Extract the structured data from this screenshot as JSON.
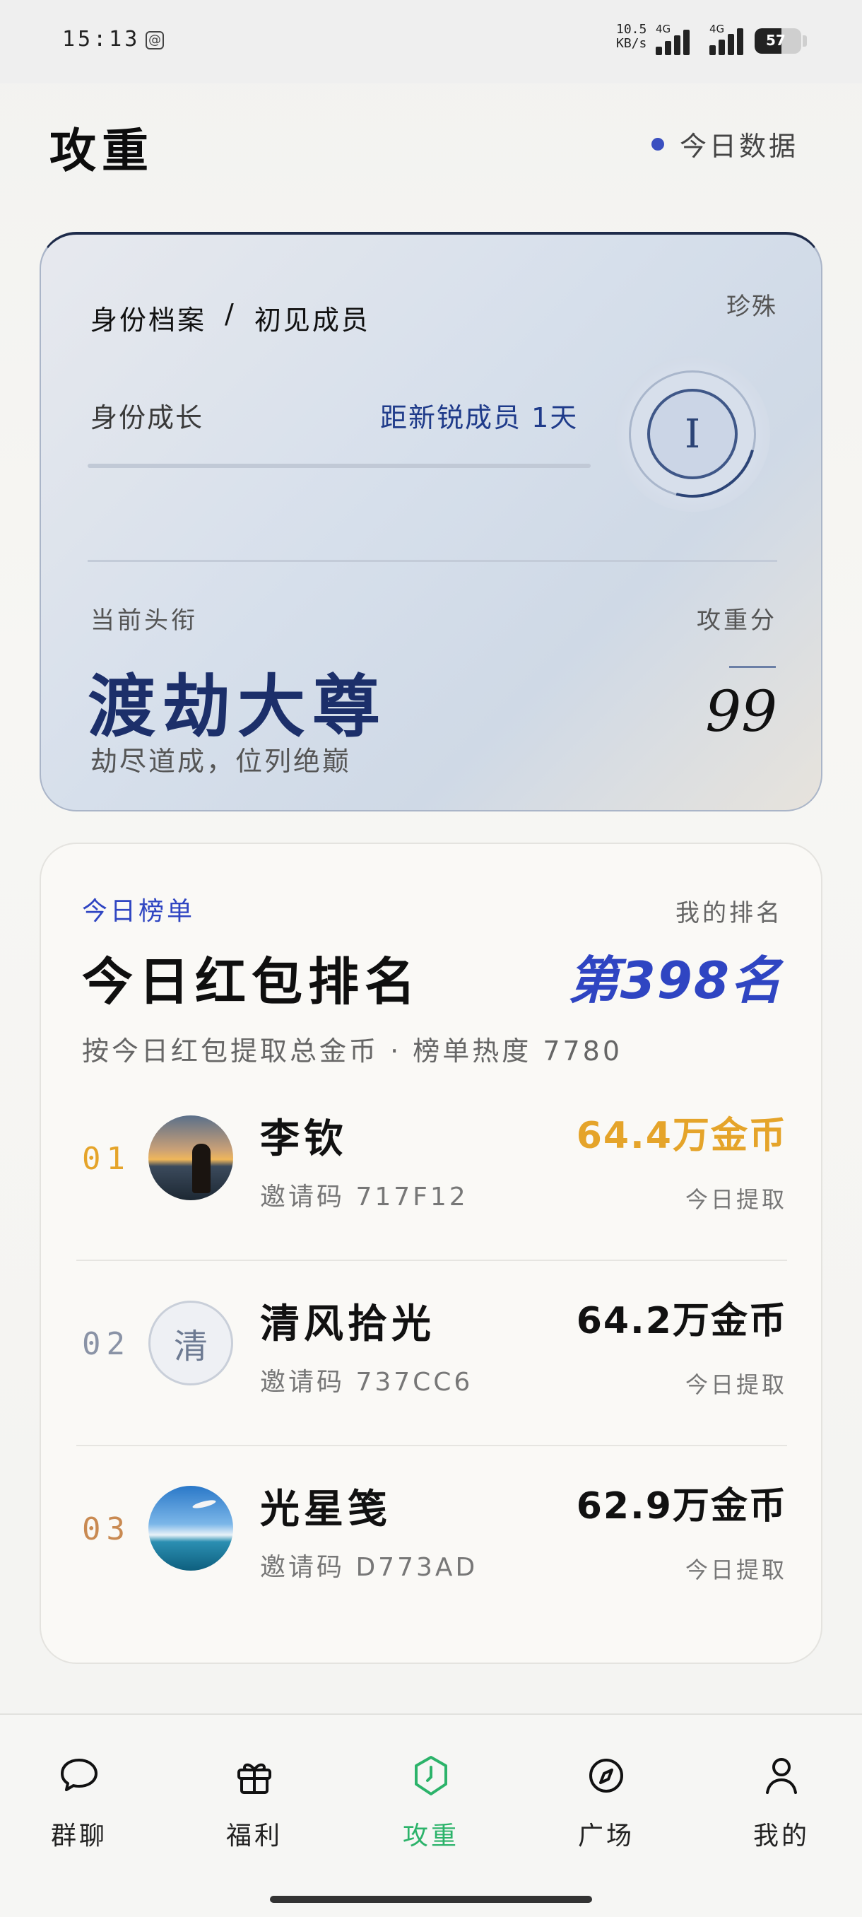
{
  "status_bar": {
    "time": "15:13",
    "at_icon": "@",
    "net_speed_top": "10.5",
    "net_speed_bottom": "KB/s",
    "signal_label_1": "4G",
    "signal_label_2": "4G",
    "battery": "57",
    "battery_level": 0.57
  },
  "header": {
    "title": "攻重",
    "today_data": "今日数据",
    "accent": "#3a4fc0"
  },
  "identity_card": {
    "breadcrumb_1": "身份档案",
    "breadcrumb_sep": "/",
    "breadcrumb_2": "初见成员",
    "rarity": "珍殊",
    "growth_label": "身份成长",
    "growth_hint": "距新锐成员 1天",
    "growth_progress": 0.0,
    "level": "I",
    "title_label": "当前头衔",
    "score_label": "攻重分",
    "title_name": "渡劫大尊",
    "title_desc": "劫尽道成，位列绝巅",
    "score": "99"
  },
  "ranking": {
    "tag": "今日榜单",
    "my_rank_label": "我的排名",
    "title": "今日红包排名",
    "my_rank_value": "第398名",
    "subtitle": "按今日红包提取总金币 · 榜单热度 7780",
    "rows": [
      {
        "no": "01",
        "name": "李钦",
        "code": "邀请码 717F12",
        "amount": "64.4万金币",
        "caption": "今日提取",
        "avatar": "sunset-photo",
        "color": "#e5a42a"
      },
      {
        "no": "02",
        "name": "清风拾光",
        "code": "邀请码 737CC6",
        "amount": "64.2万金币",
        "caption": "今日提取",
        "avatar_initial": "清",
        "color": "#8a93a6"
      },
      {
        "no": "03",
        "name": "光星笺",
        "code": "邀请码 D773AD",
        "amount": "62.9万金币",
        "caption": "今日提取",
        "avatar": "sea-photo",
        "color": "#c98a52"
      }
    ]
  },
  "bottom_nav": {
    "items": [
      {
        "label": "群聊",
        "icon": "chat-bubble-icon"
      },
      {
        "label": "福利",
        "icon": "gift-icon"
      },
      {
        "label": "攻重",
        "icon": "hexagon-clock-icon",
        "active": true
      },
      {
        "label": "广场",
        "icon": "compass-icon"
      },
      {
        "label": "我的",
        "icon": "person-icon"
      }
    ],
    "active_color": "#2cb36a"
  }
}
